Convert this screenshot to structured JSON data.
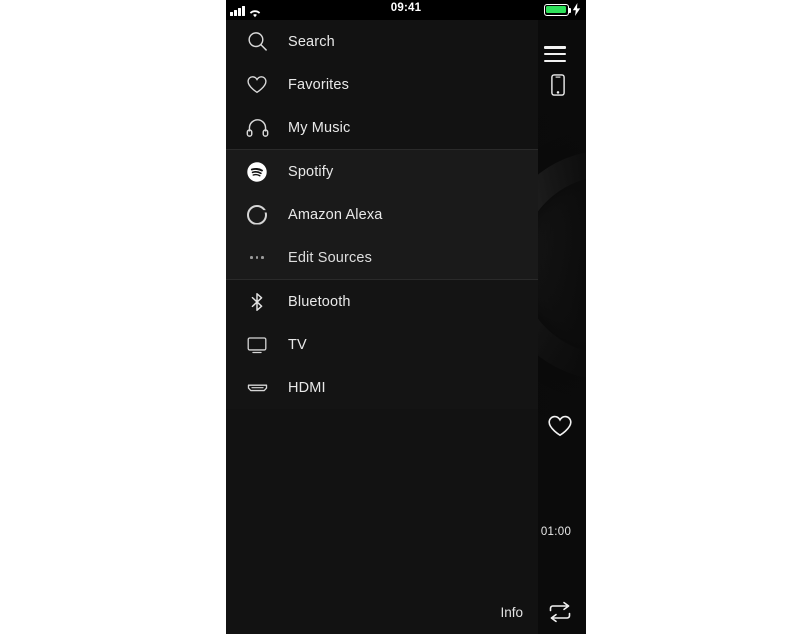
{
  "device": {
    "screen_bg": "#0d0d0d",
    "page_bg": "#ffffff"
  },
  "status_bar": {
    "signal_icon": "signal-bars-icon",
    "signal_bars": 4,
    "wifi_icon": "wifi-icon",
    "time": "09:41",
    "battery_icon": "battery-icon",
    "battery_level_percent": 100,
    "battery_color": "#2ee05a",
    "charging_icon": "lightning-bolt-icon",
    "charging": true
  },
  "now_playing": {
    "menu_button": "hamburger-menu-icon",
    "device_button": "phone-device-icon",
    "favorite_button": "heart-outline-icon",
    "elapsed_time": "01:00",
    "repeat_button": "repeat-icon",
    "artwork": "album-art-disc"
  },
  "menu": {
    "info_label": "Info",
    "sections": [
      {
        "id": "library",
        "items": [
          {
            "label": "Search",
            "icon": "search-icon"
          },
          {
            "label": "Favorites",
            "icon": "heart-outline-icon"
          },
          {
            "label": "My Music",
            "icon": "headphones-icon"
          }
        ]
      },
      {
        "id": "services",
        "items": [
          {
            "label": "Spotify",
            "icon": "spotify-icon"
          },
          {
            "label": "Amazon Alexa",
            "icon": "alexa-ring-icon"
          },
          {
            "label": "Edit Sources",
            "icon": "ellipsis-icon"
          }
        ]
      },
      {
        "id": "inputs",
        "items": [
          {
            "label": "Bluetooth",
            "icon": "bluetooth-icon"
          },
          {
            "label": "TV",
            "icon": "tv-icon"
          },
          {
            "label": "HDMI",
            "icon": "hdmi-icon"
          }
        ]
      }
    ]
  }
}
